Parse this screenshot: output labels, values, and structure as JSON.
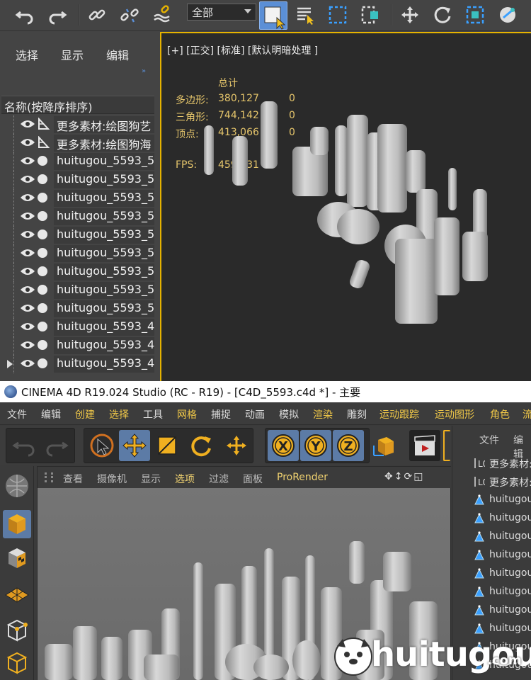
{
  "max": {
    "selection_filter": "全部",
    "scene_menu": [
      "选择",
      "显示",
      "编辑"
    ],
    "scene_header": "名称(按降序排序)",
    "scene_rows": [
      {
        "label": "更多素材:绘图狗艺",
        "type": "tri"
      },
      {
        "label": "更多素材:绘图狗海",
        "type": "tri"
      },
      {
        "label": "huitugou_5593_5",
        "type": "dot"
      },
      {
        "label": "huitugou_5593_5",
        "type": "dot"
      },
      {
        "label": "huitugou_5593_5",
        "type": "dot"
      },
      {
        "label": "huitugou_5593_5",
        "type": "dot"
      },
      {
        "label": "huitugou_5593_5",
        "type": "dot"
      },
      {
        "label": "huitugou_5593_5",
        "type": "dot"
      },
      {
        "label": "huitugou_5593_5",
        "type": "dot"
      },
      {
        "label": "huitugou_5593_5",
        "type": "dot"
      },
      {
        "label": "huitugou_5593_5",
        "type": "dot"
      },
      {
        "label": "huitugou_5593_4",
        "type": "dot"
      },
      {
        "label": "huitugou_5593_4",
        "type": "dot"
      },
      {
        "label": "huitugou_5593_4",
        "type": "dot"
      }
    ],
    "viewport_label": "[+] [正交] [标准] [默认明暗处理 ]",
    "stats": {
      "header": "总计",
      "poly_label": "多边形:",
      "poly_value": "380,127",
      "poly_sel": "0",
      "tri_label": "三角形:",
      "tri_value": "744,142",
      "tri_sel": "0",
      "vert_label": "顶点:",
      "vert_value": "413,066",
      "vert_sel": "0",
      "fps_label": "FPS:",
      "fps_value": "459.031"
    }
  },
  "c4d": {
    "title": "CINEMA 4D R19.024 Studio (RC - R19) - [C4D_5593.c4d *] - 主要",
    "menus": [
      {
        "label": "文件",
        "hl": false
      },
      {
        "label": "编辑",
        "hl": false
      },
      {
        "label": "创建",
        "hl": true
      },
      {
        "label": "选择",
        "hl": true
      },
      {
        "label": "工具",
        "hl": false
      },
      {
        "label": "网格",
        "hl": true
      },
      {
        "label": "捕捉",
        "hl": false
      },
      {
        "label": "动画",
        "hl": false
      },
      {
        "label": "模拟",
        "hl": false
      },
      {
        "label": "渲染",
        "hl": true
      },
      {
        "label": "雕刻",
        "hl": false
      },
      {
        "label": "运动跟踪",
        "hl": true
      },
      {
        "label": "运动图形",
        "hl": true
      },
      {
        "label": "角色",
        "hl": true
      },
      {
        "label": "流",
        "hl": true
      }
    ],
    "axis_x": "X",
    "axis_y": "Y",
    "axis_z": "Z",
    "view_menu": [
      {
        "label": "查看",
        "hl": false
      },
      {
        "label": "摄像机",
        "hl": false
      },
      {
        "label": "显示",
        "hl": false
      },
      {
        "label": "选项",
        "hl": true
      },
      {
        "label": "过滤",
        "hl": false
      },
      {
        "label": "面板",
        "hl": false
      },
      {
        "label": "ProRender",
        "hl": true
      }
    ],
    "right_menu": [
      "文件",
      "编辑"
    ],
    "right_rows": [
      {
        "label": "更多素材:",
        "type": "null"
      },
      {
        "label": "更多素材:",
        "type": "null"
      },
      {
        "label": "huitugou",
        "type": "obj"
      },
      {
        "label": "huitugou",
        "type": "obj"
      },
      {
        "label": "huitugou",
        "type": "obj"
      },
      {
        "label": "huitugou",
        "type": "obj"
      },
      {
        "label": "huitugou",
        "type": "obj"
      },
      {
        "label": "huitugou",
        "type": "obj"
      },
      {
        "label": "huitugou",
        "type": "obj"
      },
      {
        "label": "huitugou",
        "type": "obj"
      },
      {
        "label": "huitugou",
        "type": "obj"
      },
      {
        "label": "huitugou",
        "type": "obj"
      }
    ]
  },
  "watermark": {
    "text": "huitugou",
    "domain": ".com"
  },
  "colors": {
    "viewport_border": "#e5b200",
    "stat_text": "#e5c56b",
    "menu_highlight": "#f0c848",
    "selected_tool": "#5c7ba6"
  }
}
